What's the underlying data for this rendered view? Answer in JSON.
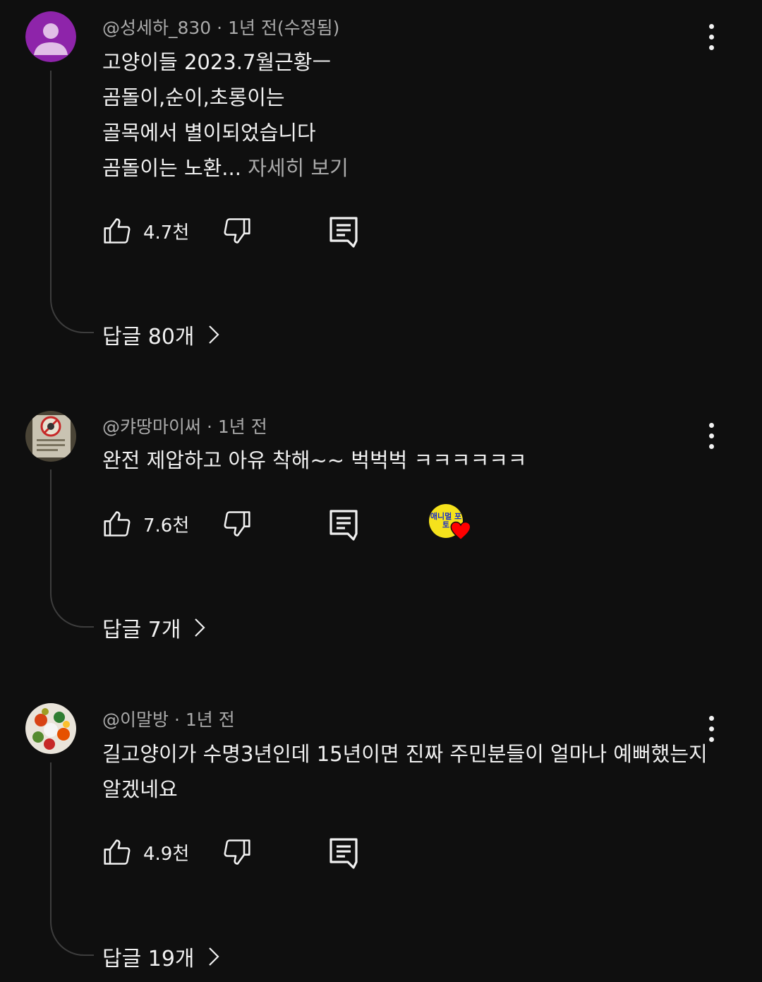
{
  "comments": [
    {
      "author": "@성세하_830",
      "meta_sep": " · ",
      "time": "1년 전(수정됨)",
      "lines": [
        "고양이들 2023.7월근황ㅡ",
        "곰돌이,순이,초롱이는",
        "골목에서 별이되었습니다",
        "곰돌이는 노환..."
      ],
      "read_more": "자세히 보기",
      "likes": "4.7천",
      "replies": "답글 80개",
      "avatar_color": "#8e24aa"
    },
    {
      "author": "@캬땅마이써",
      "meta_sep": " · ",
      "time": "1년 전",
      "lines": [
        "완전 제압하고 아유 착해~~ 벅벅벅 ㅋㅋㅋㅋㅋㅋ"
      ],
      "likes": "7.6천",
      "replies": "답글 7개",
      "creator_badge_text": "애니멀 포토"
    },
    {
      "author": "@이말방",
      "meta_sep": " · ",
      "time": "1년 전",
      "lines": [
        "길고양이가 수명3년인데 15년이면 진짜 주민분들이 얼마나 예뻐했는지",
        "알겠네요"
      ],
      "likes": "4.9천",
      "replies": "답글 19개"
    }
  ],
  "icons": {
    "more": "more-vert-icon",
    "like": "thumb-up-icon",
    "dislike": "thumb-down-icon",
    "reply": "reply-comment-icon",
    "chevron": "chevron-right-icon",
    "heart": "creator-heart-icon"
  }
}
